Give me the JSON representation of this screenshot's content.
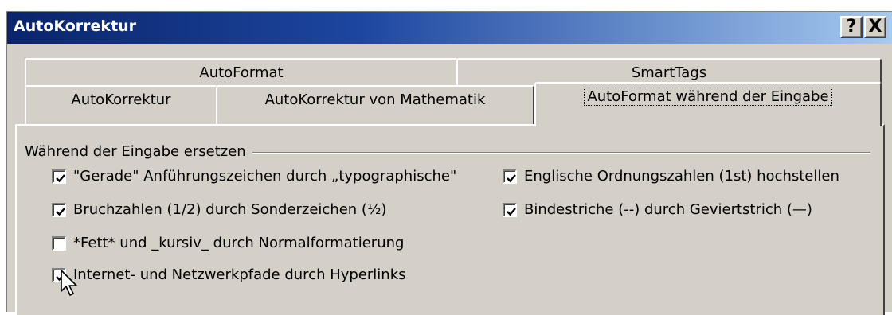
{
  "window": {
    "title": "AutoKorrektur",
    "help_button": "?",
    "close_button": "X"
  },
  "tabs_back": [
    {
      "label": "AutoFormat"
    },
    {
      "label": "SmartTags"
    }
  ],
  "tabs_front": [
    {
      "label": "AutoKorrektur"
    },
    {
      "label": "AutoKorrektur von Mathematik"
    },
    {
      "label": "AutoFormat während der Eingabe",
      "active": true
    }
  ],
  "group": {
    "title": "Während der Eingabe ersetzen",
    "options": [
      {
        "label": "\"Gerade\" Anführungszeichen durch „typographische\"",
        "checked": true
      },
      {
        "label": "Englische Ordnungszahlen (1st) hochstellen",
        "checked": true
      },
      {
        "label": "Bruchzahlen (1/2) durch Sonderzeichen (½)",
        "checked": true
      },
      {
        "label": "Bindestriche (--) durch Geviertstrich (—)",
        "checked": true
      },
      {
        "label": "*Fett* und _kursiv_ durch Normalformatierung",
        "checked": false
      },
      {
        "label": "Internet- und Netzwerkpfade durch Hyperlinks",
        "checked": true
      }
    ]
  },
  "icons": {
    "checkmark": "checkmark-icon",
    "cursor": "mouse-pointer-icon"
  }
}
